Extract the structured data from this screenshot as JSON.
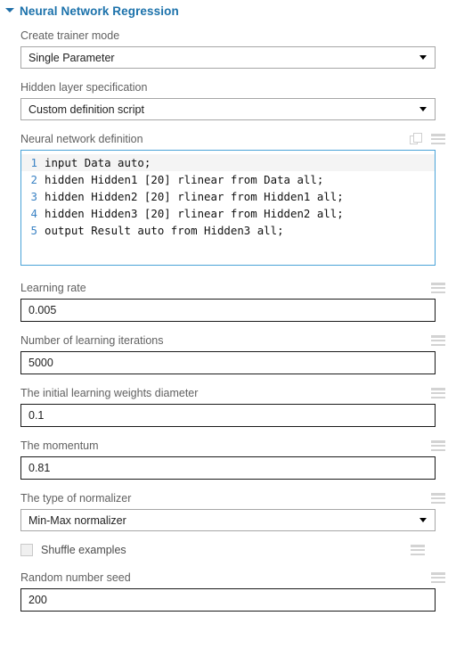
{
  "header": {
    "title": "Neural Network Regression",
    "collapse_icon": "triangle-down-icon",
    "accent_color": "#1c72ab"
  },
  "fields": {
    "trainer_mode": {
      "label": "Create trainer mode",
      "value": "Single Parameter",
      "type": "dropdown"
    },
    "hidden_layer_spec": {
      "label": "Hidden layer specification",
      "value": "Custom definition script",
      "type": "dropdown"
    },
    "network_definition": {
      "label": "Neural network definition",
      "type": "code-editor",
      "copy_icon": "copy-icon",
      "menu_icon": "hamburger-menu-icon",
      "lines": [
        {
          "number": "1",
          "text": "input Data auto;"
        },
        {
          "number": "2",
          "text": "hidden Hidden1 [20] rlinear from Data all;"
        },
        {
          "number": "3",
          "text": "hidden Hidden2 [20] rlinear from Hidden1 all;"
        },
        {
          "number": "4",
          "text": "hidden Hidden3 [20] rlinear from Hidden2 all;"
        },
        {
          "number": "5",
          "text": "output Result auto from Hidden3 all;"
        }
      ]
    },
    "learning_rate": {
      "label": "Learning rate",
      "value": "0.005",
      "type": "textbox",
      "menu_icon": "hamburger-menu-icon"
    },
    "learning_iterations": {
      "label": "Number of learning iterations",
      "value": "5000",
      "type": "textbox",
      "menu_icon": "hamburger-menu-icon"
    },
    "weights_diameter": {
      "label": "The initial learning weights diameter",
      "value": "0.1",
      "type": "textbox",
      "menu_icon": "hamburger-menu-icon"
    },
    "momentum": {
      "label": "The momentum",
      "value": "0.81",
      "type": "textbox",
      "menu_icon": "hamburger-menu-icon"
    },
    "normalizer": {
      "label": "The type of normalizer",
      "value": "Min-Max normalizer",
      "type": "dropdown",
      "menu_icon": "hamburger-menu-icon"
    },
    "shuffle_examples": {
      "label": "Shuffle examples",
      "checked": false,
      "type": "checkbox",
      "menu_icon": "hamburger-menu-icon"
    },
    "random_seed": {
      "label": "Random number seed",
      "value": "200",
      "type": "textbox",
      "menu_icon": "hamburger-menu-icon"
    }
  }
}
